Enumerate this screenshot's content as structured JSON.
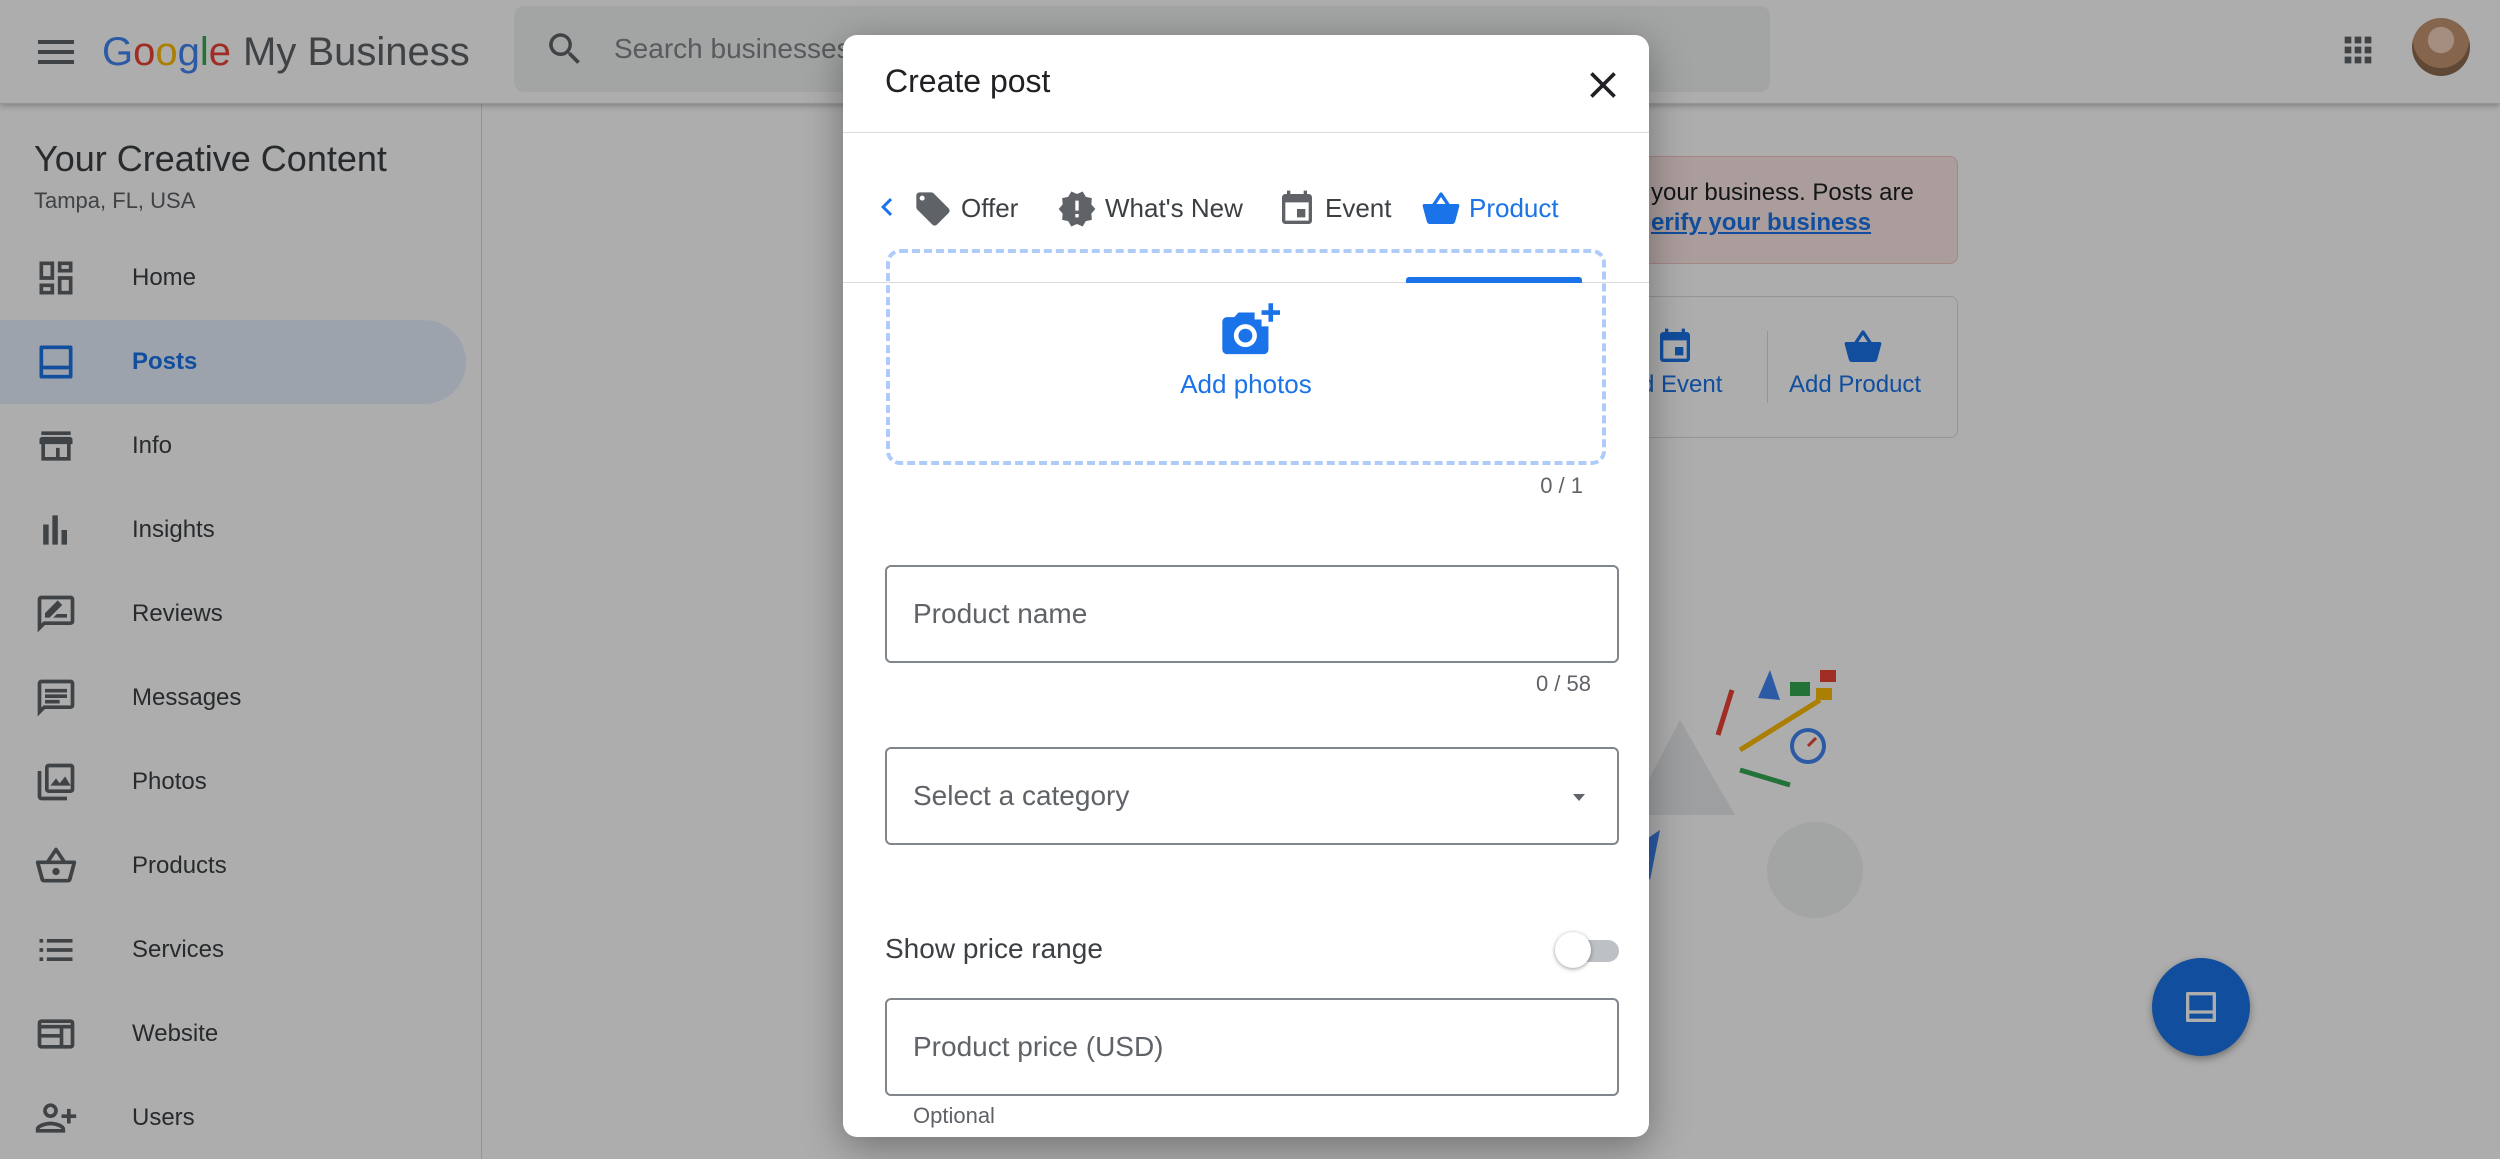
{
  "app": {
    "logo_letters": [
      "G",
      "o",
      "o",
      "g",
      "l",
      "e"
    ],
    "logo_suffix": "My Business",
    "search_placeholder": "Search businesses"
  },
  "business": {
    "name": "Your Creative Content",
    "location": "Tampa, FL, USA"
  },
  "sidebar": {
    "items": [
      {
        "label": "Home",
        "icon": "dashboard-icon",
        "active": false
      },
      {
        "label": "Posts",
        "icon": "posts-icon",
        "active": true
      },
      {
        "label": "Info",
        "icon": "storefront-icon",
        "active": false
      },
      {
        "label": "Insights",
        "icon": "bar-chart-icon",
        "active": false
      },
      {
        "label": "Reviews",
        "icon": "rate-review-icon",
        "active": false
      },
      {
        "label": "Messages",
        "icon": "chat-icon",
        "active": false
      },
      {
        "label": "Photos",
        "icon": "photo-library-icon",
        "active": false
      },
      {
        "label": "Products",
        "icon": "shopping-basket-icon",
        "active": false
      },
      {
        "label": "Services",
        "icon": "list-icon",
        "active": false
      },
      {
        "label": "Website",
        "icon": "web-icon",
        "active": false
      },
      {
        "label": "Users",
        "icon": "person-add-icon",
        "active": false
      }
    ]
  },
  "background": {
    "banner_line1": "your business. Posts are",
    "banner_link": "erify your business",
    "quick_event_label": "d Event",
    "quick_product_label": "Add Product"
  },
  "dialog": {
    "title": "Create post",
    "tabs": [
      {
        "label": "Offer",
        "icon": "tag-icon",
        "active": false
      },
      {
        "label": "What's New",
        "icon": "new-releases-icon",
        "active": false
      },
      {
        "label": "Event",
        "icon": "event-icon",
        "active": false
      },
      {
        "label": "Product",
        "icon": "shopping-basket-icon",
        "active": true
      }
    ],
    "add_photos_label": "Add photos",
    "photo_count": "0 / 1",
    "product_name_placeholder": "Product name",
    "product_name_value": "",
    "product_name_count": "0 / 58",
    "category_placeholder": "Select a category",
    "price_range_label": "Show price range",
    "price_range_enabled": false,
    "product_price_placeholder": "Product price (USD)",
    "product_price_value": "",
    "price_hint": "Optional"
  },
  "colors": {
    "accent": "#1a73e8",
    "active_nav_bg": "#e8f0fe",
    "google_blue": "#4285f4",
    "google_red": "#ea4335",
    "google_yellow": "#fbbc05",
    "google_green": "#34a853"
  }
}
